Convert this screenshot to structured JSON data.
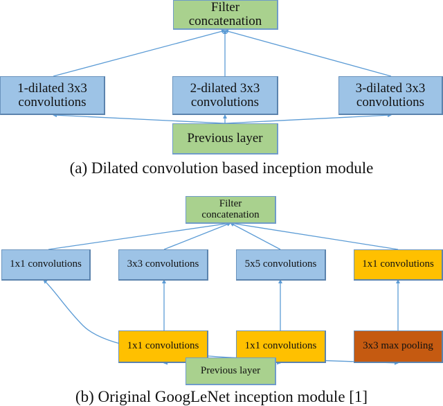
{
  "diagram_a": {
    "caption": "(a) Dilated convolution based inception module",
    "filter_concat": [
      "Filter",
      "concatenation"
    ],
    "branches": [
      {
        "line1": "1-dilated 3x3",
        "line2": "convolutions"
      },
      {
        "line1": "2-dilated 3x3",
        "line2": "convolutions"
      },
      {
        "line1": "3-dilated 3x3",
        "line2": "convolutions"
      }
    ],
    "previous_layer": "Previous layer"
  },
  "diagram_b": {
    "caption": "(b) Original GoogLeNet inception module [1]",
    "filter_concat": [
      "Filter",
      "concatenation"
    ],
    "top_row": [
      {
        "label": "1x1 convolutions",
        "color": "#9dc3e6"
      },
      {
        "label": "3x3 convolutions",
        "color": "#9dc3e6"
      },
      {
        "label": "5x5 convolutions",
        "color": "#9dc3e6"
      },
      {
        "label": "1x1 convolutions",
        "color": "#ffc000"
      }
    ],
    "bottom_row": [
      {
        "label": "1x1 convolutions",
        "color": "#ffc000"
      },
      {
        "label": "1x1 convolutions",
        "color": "#ffc000"
      },
      {
        "label": "3x3 max pooling",
        "color": "#c55a11"
      }
    ],
    "previous_layer": "Previous layer"
  },
  "colors": {
    "green": "#a9d18e",
    "blue": "#9dc3e6",
    "yellow": "#ffc000",
    "orange": "#c55a11",
    "arrow": "#5b9bd5"
  }
}
